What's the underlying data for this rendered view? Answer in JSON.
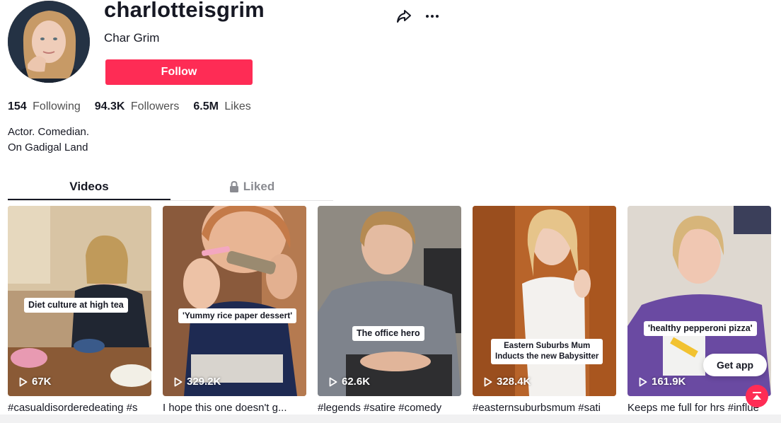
{
  "profile": {
    "username": "charlotteisgrim",
    "nickname": "Char Grim",
    "follow_label": "Follow"
  },
  "stats": {
    "following_count": "154",
    "following_label": "Following",
    "followers_count": "94.3K",
    "followers_label": "Followers",
    "likes_count": "6.5M",
    "likes_label": "Likes"
  },
  "bio": {
    "line1": "Actor. Comedian.",
    "line2": "On Gadigal Land"
  },
  "tabs": [
    {
      "label": "Videos",
      "active": true
    },
    {
      "label": "Liked",
      "active": false,
      "icon": "lock-icon"
    }
  ],
  "videos": [
    {
      "caption": "Diet culture at high tea",
      "views": "67K",
      "description": "#casualdisorderedeating #s"
    },
    {
      "caption": "'Yummy rice paper dessert'",
      "views": "329.2K",
      "description": "I hope this one doesn't g..."
    },
    {
      "caption": "The office hero",
      "views": "62.6K",
      "description": "#legends #satire #comedy"
    },
    {
      "caption": "Eastern Suburbs Mum Inducts the new Babysitter",
      "caption_line1": "Eastern Suburbs Mum",
      "caption_line2": "Inducts the new Babysitter",
      "views": "328.4K",
      "description": "#easternsuburbsmum #sati"
    },
    {
      "caption": "'healthy pepperoni pizza'",
      "views": "161.9K",
      "description": "Keeps me full for hrs #influe"
    }
  ],
  "floating": {
    "get_app_label": "Get app"
  },
  "colors": {
    "accent": "#fe2c55",
    "text": "#161823",
    "muted": "#8a8b91"
  }
}
